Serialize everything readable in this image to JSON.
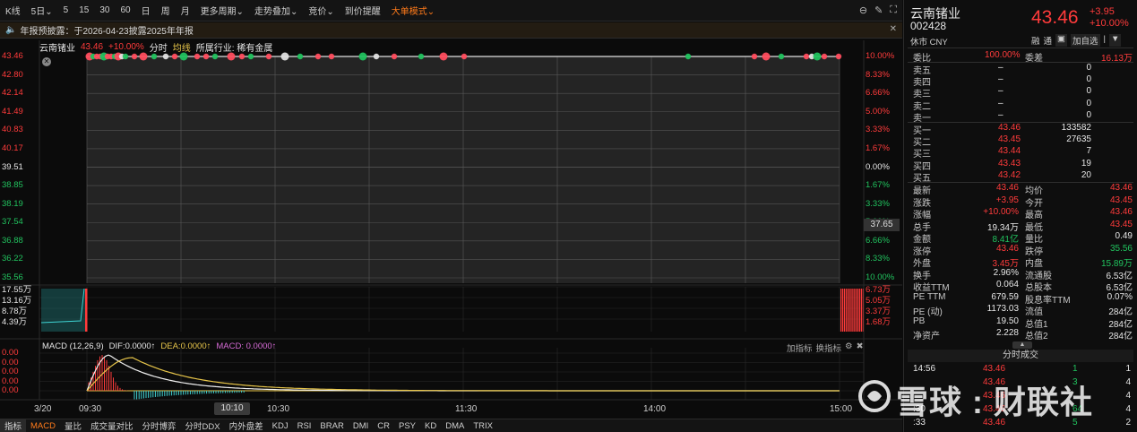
{
  "toolbar": {
    "items": [
      "K线",
      "5日⌄",
      "5",
      "15",
      "30",
      "60",
      "日",
      "周",
      "月",
      "更多周期⌄",
      "走势叠加⌄",
      "竞价⌄",
      "到价提醒",
      "大单模式⌄"
    ],
    "active_index": 13
  },
  "notice": {
    "text": "年报预披露：于2026-04-23披露2025年年报"
  },
  "infoline": {
    "name": "云南锗业",
    "price": "43.46",
    "pct": "+10.00%",
    "fenshi": "分时",
    "avg": "均线",
    "industry": "所属行业: 稀有金属"
  },
  "price_axis": {
    "left": [
      "43.46",
      "42.80",
      "42.14",
      "41.49",
      "40.83",
      "40.17",
      "39.51",
      "38.85",
      "38.19",
      "37.54",
      "36.88",
      "36.22",
      "35.56"
    ],
    "right": [
      "10.00%",
      "8.33%",
      "6.66%",
      "5.00%",
      "3.33%",
      "1.67%",
      "0.00%",
      "1.67%",
      "3.33%",
      "5.00%",
      "6.66%",
      "8.33%",
      "10.00%"
    ],
    "cursor_value": "37.65"
  },
  "volume_axis": {
    "left": [
      "17.55万",
      "13.16万",
      "8.78万",
      "4.39万"
    ],
    "right": [
      "6.73万",
      "5.05万",
      "3.37万",
      "1.68万"
    ]
  },
  "macd": {
    "title": "MACD (12,26,9)",
    "dif": "DIF:0.0000↑",
    "dea": "DEA:0.0000↑",
    "macd": "MACD: 0.0000↑",
    "tools": [
      "加指标",
      "换指标"
    ],
    "axis": [
      "0.00",
      "0.00",
      "0.00",
      "0.00",
      "0.00"
    ]
  },
  "time_axis": {
    "date": "3/20",
    "labels": [
      "09:30",
      "10:30",
      "11:30",
      "14:00",
      "15:00"
    ],
    "cursor": "10:10"
  },
  "bottom_tabs": [
    "指标",
    "MACD",
    "量比",
    "成交量对比",
    "分时博弈",
    "分时DDX",
    "内外盘差",
    "KDJ",
    "RSI",
    "BRAR",
    "DMI",
    "CR",
    "PSY",
    "KD",
    "DMA",
    "TRIX"
  ],
  "panel": {
    "name": "云南锗业",
    "code": "002428",
    "currency": "休市 CNY",
    "price": "43.46",
    "change": "+3.95",
    "change_pct": "+10.00%",
    "buttons": [
      "融",
      "通",
      "▣",
      "加自选",
      "|",
      "▼"
    ],
    "webi": {
      "label1": "委比",
      "value1": "100.00%",
      "label2": "委差",
      "value2": "16.13万"
    },
    "sells": [
      {
        "label": "卖五",
        "price": "–",
        "vol": "0"
      },
      {
        "label": "卖四",
        "price": "–",
        "vol": "0"
      },
      {
        "label": "卖三",
        "price": "–",
        "vol": "0"
      },
      {
        "label": "卖二",
        "price": "–",
        "vol": "0"
      },
      {
        "label": "卖一",
        "price": "–",
        "vol": "0"
      }
    ],
    "buys": [
      {
        "label": "买一",
        "price": "43.46",
        "vol": "133582"
      },
      {
        "label": "买二",
        "price": "43.45",
        "vol": "27635"
      },
      {
        "label": "买三",
        "price": "43.44",
        "vol": "7"
      },
      {
        "label": "买四",
        "price": "43.43",
        "vol": "19"
      },
      {
        "label": "买五",
        "price": "43.42",
        "vol": "20"
      }
    ],
    "stats": [
      {
        "l1": "最新",
        "v1": "43.46",
        "c1": "red",
        "l2": "均价",
        "v2": "43.46",
        "c2": "red"
      },
      {
        "l1": "涨跌",
        "v1": "+3.95",
        "c1": "red",
        "l2": "今开",
        "v2": "43.45",
        "c2": "red"
      },
      {
        "l1": "涨幅",
        "v1": "+10.00%",
        "c1": "red",
        "l2": "最高",
        "v2": "43.46",
        "c2": "red"
      },
      {
        "l1": "总手",
        "v1": "19.34万",
        "c1": "white",
        "l2": "最低",
        "v2": "43.45",
        "c2": "red"
      },
      {
        "l1": "金额",
        "v1": "8.41亿",
        "c1": "green",
        "l2": "量比",
        "v2": "0.49",
        "c2": "white"
      },
      {
        "l1": "涨停",
        "v1": "43.46",
        "c1": "red",
        "l2": "跌停",
        "v2": "35.56",
        "c2": "green"
      },
      {
        "l1": "外盘",
        "v1": "3.45万",
        "c1": "red",
        "l2": "内盘",
        "v2": "15.89万",
        "c2": "green"
      },
      {
        "l1": "换手",
        "v1": "2.96%",
        "c1": "white",
        "l2": "流通股",
        "v2": "6.53亿",
        "c2": "white"
      },
      {
        "l1": "收益TTM",
        "v1": "0.064",
        "c1": "white",
        "l2": "总股本",
        "v2": "6.53亿",
        "c2": "white"
      },
      {
        "l1": "PE TTM",
        "v1": "679.59",
        "c1": "white",
        "l2": "股息率TTM",
        "v2": "0.07%",
        "c2": "white"
      },
      {
        "l1": "PE (动)",
        "v1": "1173.03",
        "c1": "white",
        "l2": "流值",
        "v2": "284亿",
        "c2": "white"
      },
      {
        "l1": "PB",
        "v1": "19.50",
        "c1": "white",
        "l2": "总值1",
        "v2": "284亿",
        "c2": "white"
      },
      {
        "l1": "净资产",
        "v1": "2.228",
        "c1": "white",
        "l2": "总值2",
        "v2": "284亿",
        "c2": "white"
      }
    ],
    "ticks_title": "分时成交",
    "ticks": [
      {
        "time": "14:56",
        "price": "43.46",
        "vol": "1",
        "n": "1"
      },
      {
        "time": "",
        "price": "43.46",
        "vol": "3",
        "n": "4"
      },
      {
        "time": "",
        "price": "43.46",
        "vol": "",
        "n": "4"
      },
      {
        "time": ":30",
        "price": "43.46",
        "vol": "64",
        "n": "4"
      },
      {
        "time": ":33",
        "price": "43.46",
        "vol": "5",
        "n": "2"
      }
    ]
  },
  "watermark": {
    "text": "雪球 : 财联社"
  },
  "colors": {
    "up": "#ff3b3b",
    "down": "#21c25e",
    "accent": "#ff7a1a",
    "bg": "#0b0b0b"
  }
}
